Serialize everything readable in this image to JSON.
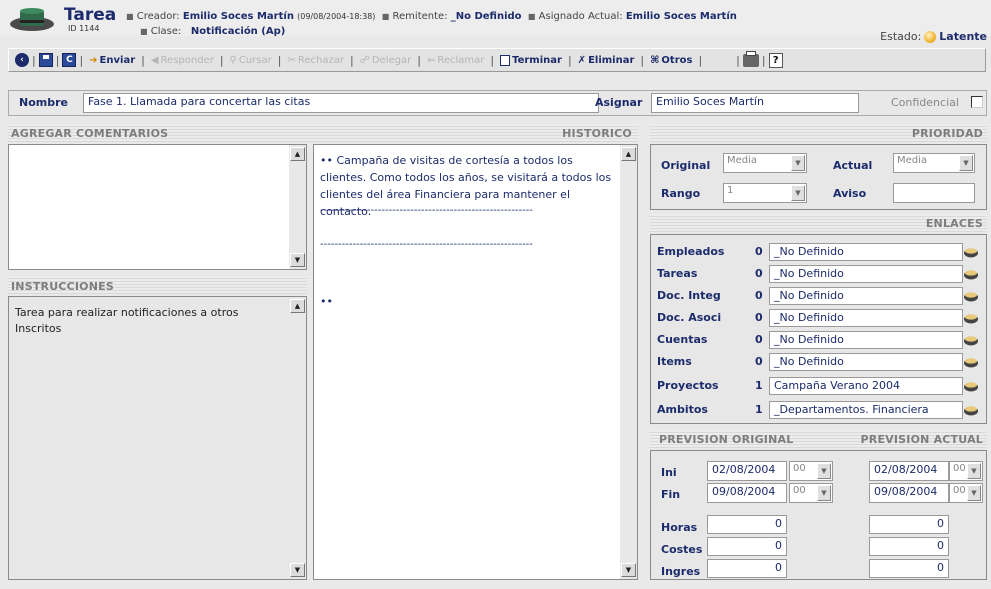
{
  "header": {
    "title": "Tarea",
    "id_label": "ID 1144",
    "creator_label": "Creador:",
    "creator_value": "Emilio Soces Martín",
    "creator_date": "(09/08/2004-18:38)",
    "sender_label": "Remitente:",
    "sender_value": "_No Definido",
    "assigned_label": "Asignado Actual:",
    "assigned_value": "Emilio Soces Martín",
    "class_label": "Clase:",
    "class_value": "Notificación (Ap)",
    "state_label": "Estado:",
    "state_value": "Latente"
  },
  "toolbar": {
    "enviar": "Enviar",
    "responder": "Responder",
    "cursar": "Cursar",
    "rechazar": "Rechazar",
    "delegar": "Delegar",
    "reclamar": "Reclamar",
    "terminar": "Terminar",
    "eliminar": "Eliminar",
    "otros": "Otros"
  },
  "form": {
    "nombre_label": "Nombre",
    "nombre_value": "Fase 1. Llamada para concertar las citas",
    "asignar_label": "Asignar",
    "asignar_value": "Emilio Soces Martín",
    "confidencial_label": "Confidencial"
  },
  "comments": {
    "header": "AGREGAR COMENTARIOS",
    "value": ""
  },
  "instructions": {
    "header": "INSTRUCCIONES",
    "text": "Tarea para realizar notificaciones a otros Inscritos"
  },
  "history": {
    "header": "HISTORICO",
    "entry1": "•• Campaña de visitas de cortesía a todos los clientes. Como todos los años, se visitará a todos los clientes del área Financiera para mantener el contacto.",
    "divider": "-----------------------------------------------------------",
    "entry2": "••"
  },
  "priority": {
    "header": "PRIORIDAD",
    "original_label": "Original",
    "original_value": "Media",
    "actual_label": "Actual",
    "actual_value": "Media",
    "rango_label": "Rango",
    "rango_value": "1",
    "aviso_label": "Aviso",
    "aviso_value": ""
  },
  "links": {
    "header": "ENLACES",
    "rows": [
      {
        "label": "Empleados",
        "count": "0",
        "value": "_No Definido"
      },
      {
        "label": "Tareas",
        "count": "0",
        "value": "_No Definido"
      },
      {
        "label": "Doc. Integ",
        "count": "0",
        "value": "_No Definido"
      },
      {
        "label": "Doc. Asoci",
        "count": "0",
        "value": "_No Definido"
      },
      {
        "label": "Cuentas",
        "count": "0",
        "value": "_No Definido"
      },
      {
        "label": "Items",
        "count": "0",
        "value": "_No Definido"
      },
      {
        "label": "Proyectos",
        "count": "1",
        "value": "Campaña Verano 2004"
      },
      {
        "label": "Ambitos",
        "count": "1",
        "value": "_Departamentos. Financiera"
      }
    ]
  },
  "forecast": {
    "original_header": "PREVISION ORIGINAL",
    "actual_header": "PREVISION ACTUAL",
    "ini_label": "Ini",
    "fin_label": "Fin",
    "ini_orig": "02/08/2004",
    "ini_orig_hour": "00",
    "fin_orig": "09/08/2004",
    "fin_orig_hour": "00",
    "ini_act": "02/08/2004",
    "ini_act_hour": "00",
    "fin_act": "09/08/2004",
    "fin_act_hour": "00",
    "horas_label": "Horas",
    "costes_label": "Costes",
    "ingres_label": "Ingres",
    "horas_orig": "0",
    "costes_orig": "0",
    "ingres_orig": "0",
    "horas_act": "0",
    "costes_act": "0",
    "ingres_act": "0"
  },
  "colors": {
    "navy": "#1c2b6b",
    "state_dot": "#f2b531",
    "hatch": "#d9d9d9"
  }
}
